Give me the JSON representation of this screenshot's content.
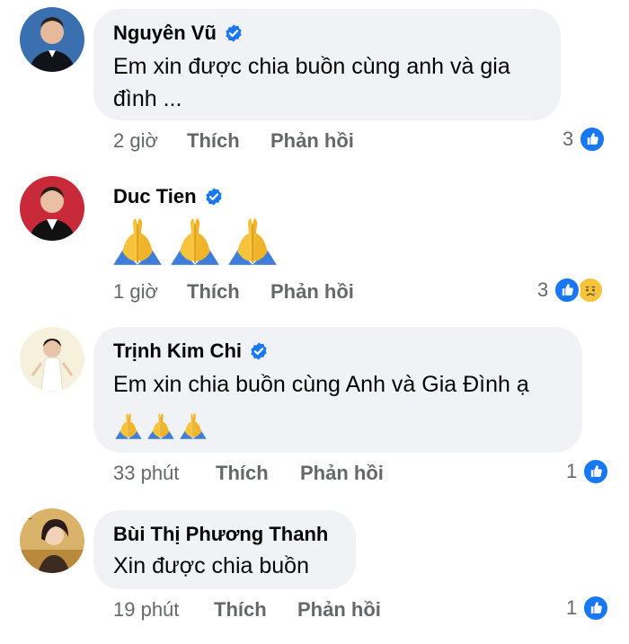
{
  "comments": [
    {
      "author": "Nguyên Vũ",
      "text": "Em xin được chia buồn cùng anh và gia đình ...",
      "time": "2 giờ",
      "like_label": "Thích",
      "reply_label": "Phản hồi",
      "reaction_count": "3",
      "reactions": [
        "like-icon"
      ]
    },
    {
      "author": "Duc Tien",
      "text": "",
      "emojis": [
        "folded-hands-emoji",
        "folded-hands-emoji",
        "folded-hands-emoji"
      ],
      "time": "1 giờ",
      "like_label": "Thích",
      "reply_label": "Phản hồi",
      "reaction_count": "3",
      "reactions": [
        "like-icon",
        "sad-icon"
      ]
    },
    {
      "author": "Trịnh Kim Chi",
      "text": "Em xin chia buồn cùng Anh và Gia Đình ạ",
      "emojis": [
        "folded-hands-emoji",
        "folded-hands-emoji",
        "folded-hands-emoji"
      ],
      "time": "33 phút",
      "like_label": "Thích",
      "reply_label": "Phản hồi",
      "reaction_count": "1",
      "reactions": [
        "like-icon"
      ]
    },
    {
      "author": "Bùi Thị Phương Thanh",
      "text": "Xin được chia buồn",
      "time": "19 phút",
      "like_label": "Thích",
      "reply_label": "Phản hồi",
      "reaction_count": "1",
      "reactions": [
        "like-icon"
      ]
    }
  ],
  "colors": {
    "bubble": "#f0f2f5",
    "meta_text": "#65676b",
    "verified": "#1877f2",
    "like": "#1877f2"
  }
}
